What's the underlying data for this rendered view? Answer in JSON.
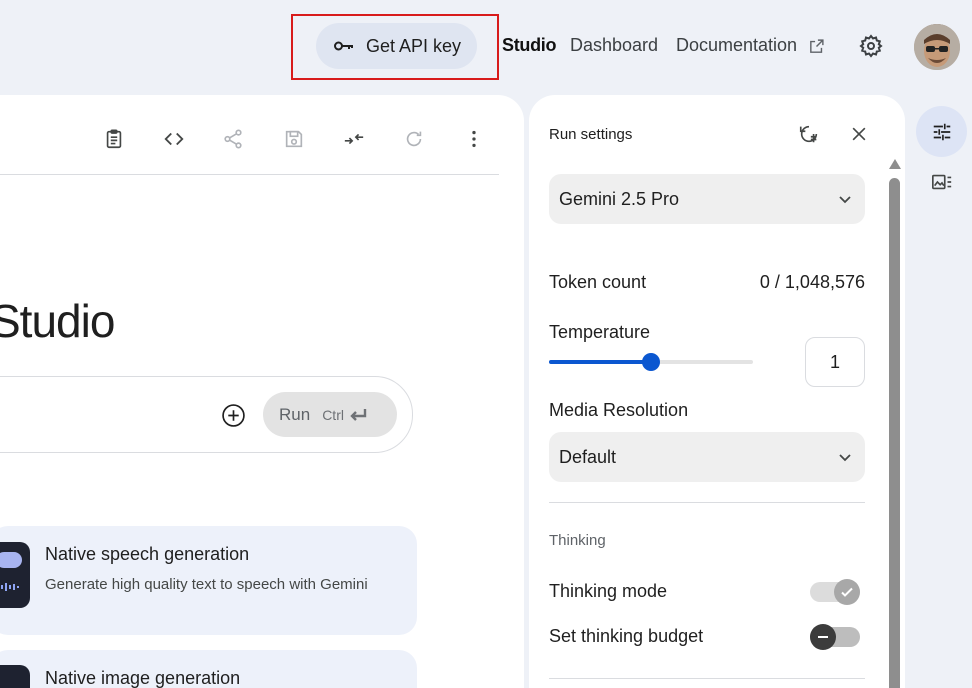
{
  "header": {
    "api_key_button": "Get API key",
    "nav": {
      "studio": "Studio",
      "dashboard": "Dashboard",
      "documentation": "Documentation"
    }
  },
  "main": {
    "title": "Studio",
    "run_button": {
      "label": "Run",
      "shortcut": "Ctrl"
    },
    "cards": [
      {
        "title": "Native speech generation",
        "description": "Generate high quality text to speech with Gemini"
      },
      {
        "title": "Native image generation"
      }
    ]
  },
  "run_settings": {
    "title": "Run settings",
    "model": "Gemini 2.5 Pro",
    "token_count_label": "Token count",
    "token_count_value": "0 / 1,048,576",
    "temperature_label": "Temperature",
    "temperature_value": "1",
    "temperature_fraction": 0.5,
    "media_resolution_label": "Media Resolution",
    "media_resolution_value": "Default",
    "thinking_section": "Thinking",
    "thinking_mode_label": "Thinking mode",
    "thinking_budget_label": "Set thinking budget"
  },
  "colors": {
    "accent": "#0b57d0",
    "highlight": "#d81b1b",
    "card_bg": "#edf1fa"
  },
  "icons": {
    "api": "key-icon",
    "external": "external-link-icon",
    "settings": "gear-icon",
    "toolbar": [
      "clipboard-icon",
      "code-icon",
      "share-icon",
      "save-icon",
      "compare-icon",
      "refresh-icon",
      "more-vert-icon"
    ],
    "rail": [
      "tune-icon",
      "media-icon"
    ]
  }
}
